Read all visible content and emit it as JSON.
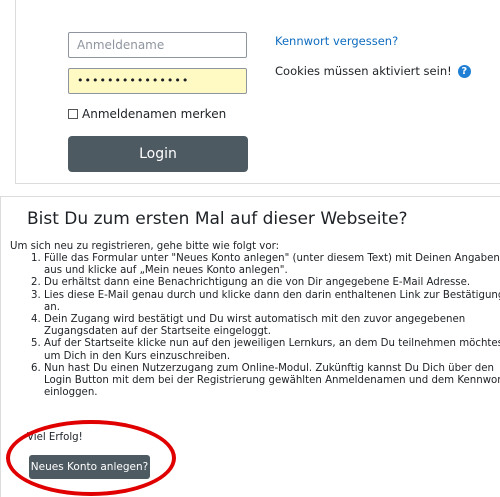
{
  "login": {
    "username_placeholder": "Anmeldename",
    "password_value": "•••••••••••••••",
    "remember_label": "Anmeldenamen merken",
    "login_label": "Login",
    "forgot_link": "Kennwort vergessen?",
    "cookies_notice": "Cookies müssen aktiviert sein!",
    "help_icon_glyph": "?"
  },
  "signup": {
    "title": "Bist Du zum ersten Mal auf dieser Webseite?",
    "intro": "Um sich neu zu registrieren, gehe bitte wie folgt vor:",
    "steps": [
      "Fülle das Formular unter \"Neues Konto anlegen\" (unter diesem Text) mit Deinen Angaben aus und klicke auf „Mein neues Konto anlegen\".",
      "Du erhältst dann eine Benachrichtigung an die von Dir angegebene E-Mail Adresse.",
      "Lies diese E-Mail genau durch und klicke dann den darin enthaltenen Link zur Bestätigung an.",
      "Dein Zugang wird bestätigt und Du wirst automatisch mit den zuvor angegebenen Zugangsdaten auf der Startseite eingeloggt.",
      "Auf der Startseite klicke nun auf den jeweiligen Lernkurs, an dem Du teilnehmen möchtest, um Dich in den Kurs einzuschreiben.",
      "Nun hast Du einen Nutzerzugang zum Online-Modul. Zukünftig kannst Du Dich über den Login Button mit dem bei der Registrierung gewählten Anmeldenamen und dem Kennwort einloggen."
    ],
    "thanks": "Viel Erfolg!",
    "new_account_label": "Neues Konto anlegen?"
  },
  "colors": {
    "accent": "#0f6cbf",
    "button": "#4e5a62",
    "password_bg": "#fff9c4",
    "highlight": "#e00000"
  }
}
